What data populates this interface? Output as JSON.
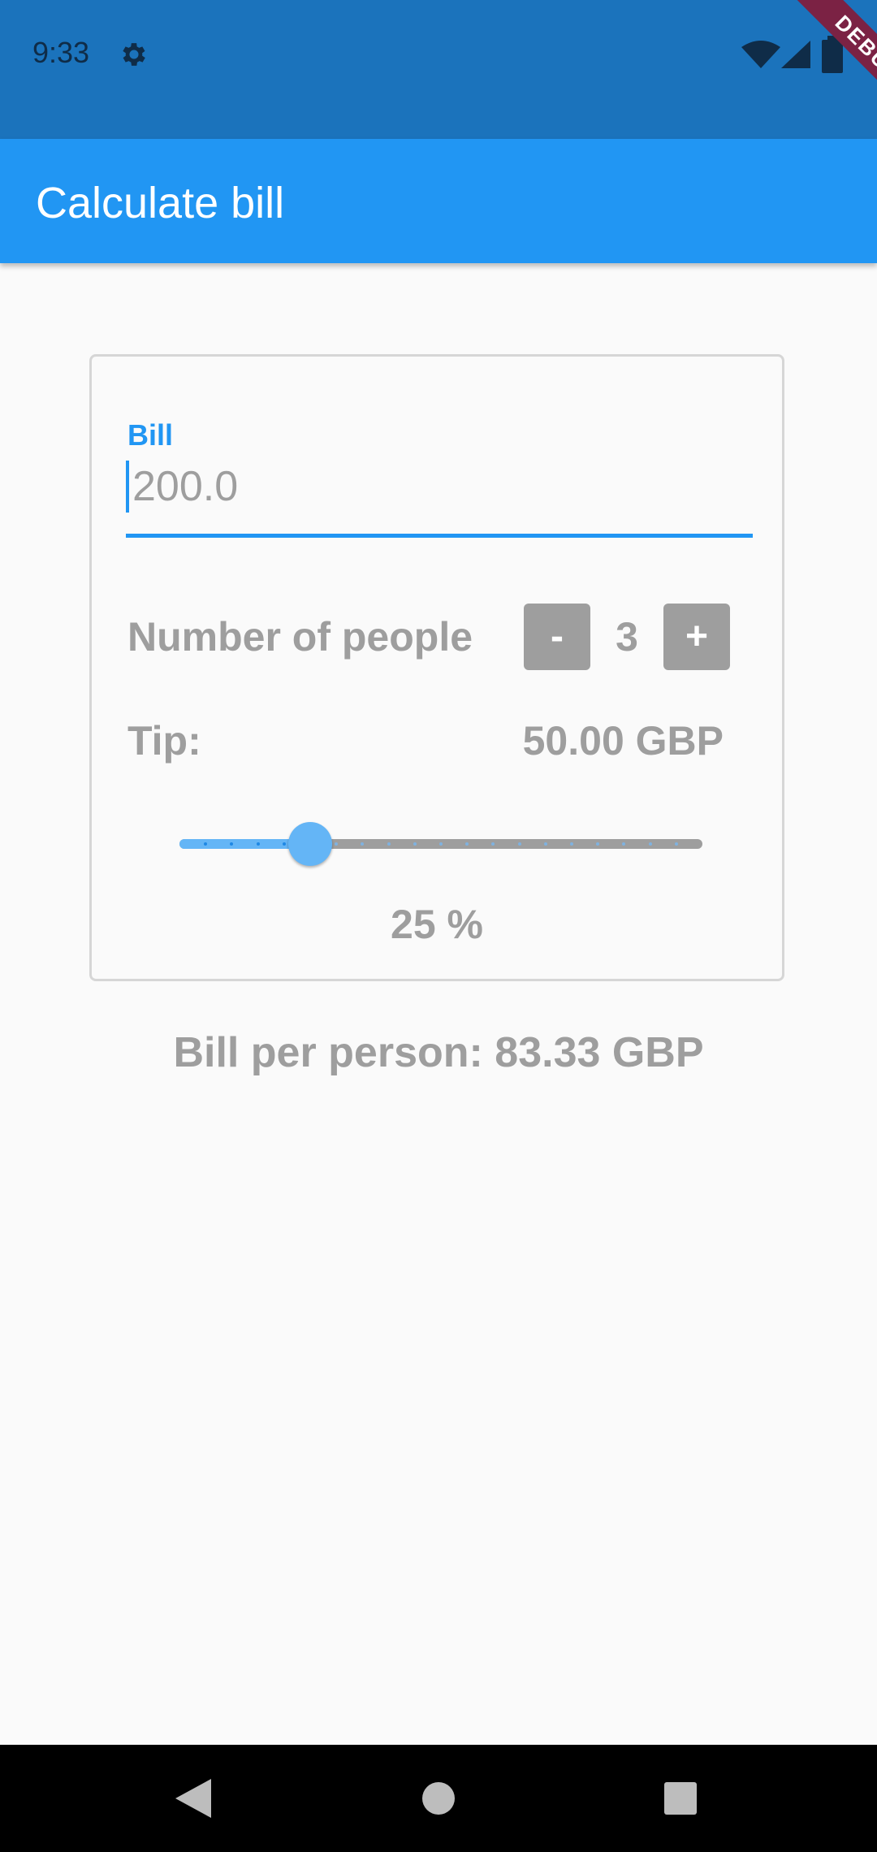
{
  "status_bar": {
    "time": "9:33",
    "debug_label": "DEBUG"
  },
  "app_bar": {
    "title": "Calculate bill"
  },
  "form": {
    "bill_label": "Bill",
    "bill_value": "200.0",
    "people_label": "Number of people",
    "minus_label": "-",
    "people_count": "3",
    "plus_label": "+",
    "tip_label": "Tip:",
    "tip_amount": "50.00 GBP",
    "tip_slider": {
      "min": 0,
      "max": 100,
      "value": 25,
      "divisions": 20
    },
    "tip_percent_text": "25 %"
  },
  "result": {
    "bill_per_person": "Bill per person: 83.33 GBP"
  },
  "colors": {
    "primary": "#2196f3",
    "primary_dark": "#1b73bc",
    "slider_active": "#64b5f6",
    "inactive_grey": "#9e9e9e"
  },
  "icons": {
    "status": [
      "gear-icon",
      "wifi-icon",
      "signal-icon",
      "battery-icon"
    ],
    "nav": [
      "back-icon",
      "home-icon",
      "recents-icon"
    ]
  }
}
